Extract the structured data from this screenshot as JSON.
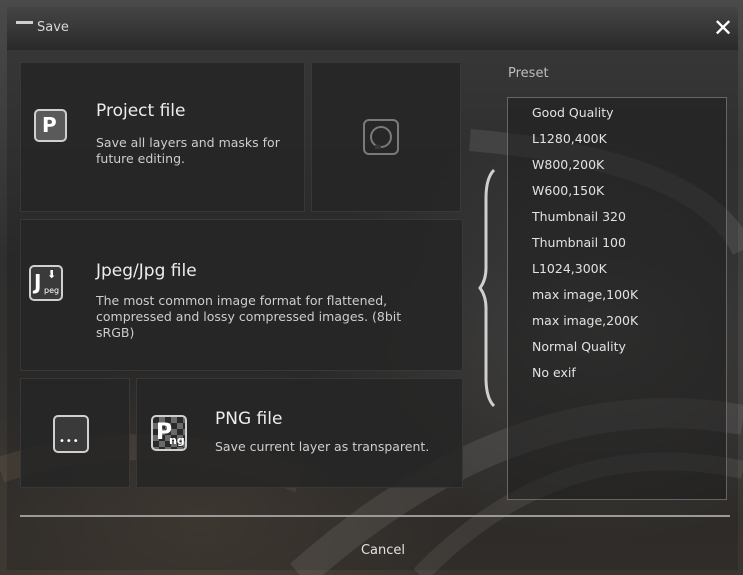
{
  "window": {
    "title": "Save",
    "close_glyph": "✕"
  },
  "tiles": {
    "project": {
      "title": "Project file",
      "desc_line1": "Save all layers and masks for",
      "desc_line2": "future editing.",
      "icon": "project-file-icon",
      "icon_letter": "P"
    },
    "restore": {
      "icon": "circle-restore-icon"
    },
    "jpeg": {
      "title": "Jpeg/Jpg file",
      "desc_line1": "The most common image format for flattened,",
      "desc_line2": "compressed and lossy compressed images. (8bit",
      "desc_line3": "sRGB)",
      "icon": "jpeg-file-icon",
      "icon_letter": "J",
      "icon_sub": "peg"
    },
    "more": {
      "icon": "more-formats-icon",
      "glyph": "•••"
    },
    "png": {
      "title": "PNG file",
      "desc": "Save current layer as transparent.",
      "icon": "png-file-icon",
      "icon_letter": "P",
      "icon_sub": "ng"
    }
  },
  "preset": {
    "heading": "Preset",
    "items": [
      "Good Quality",
      "L1280,400K",
      "W800,200K",
      "W600,150K",
      "Thumbnail 320",
      "Thumbnail 100",
      "L1024,300K",
      "max image,100K",
      "max image,200K",
      "Normal Quality",
      "No exif"
    ]
  },
  "footer": {
    "cancel_label": "Cancel"
  },
  "colors": {
    "accent": "#e8e8e8",
    "tile_bg": "#262626",
    "divider": "#9a9a9a"
  }
}
